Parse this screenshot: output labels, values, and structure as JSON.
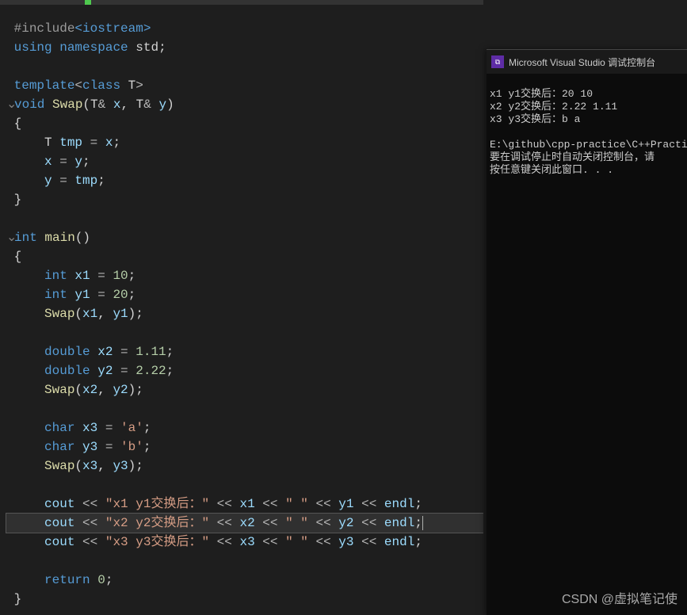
{
  "code": {
    "l1a": "#include",
    "l1b": "<iostream>",
    "l2a": "using",
    "l2b": " namespace ",
    "l2c": "std",
    "l2d": ";",
    "l4a": "template",
    "l4b": "<",
    "l4c": "class",
    "l4d": " T",
    "l4e": ">",
    "l5a": "void",
    "l5b": "Swap",
    "l5c": "(",
    "l5d": "T",
    "l5e": "&",
    "l5f": " x",
    "l5g": ", ",
    "l5h": "T",
    "l5i": "&",
    "l5j": " y",
    "l5k": ")",
    "l6": "{",
    "l7a": "T",
    "l7b": " tmp ",
    "l7c": "=",
    "l7d": " x",
    "l7e": ";",
    "l8a": "x ",
    "l8b": "=",
    "l8c": " y",
    "l8d": ";",
    "l9a": "y ",
    "l9b": "=",
    "l9c": " tmp",
    "l9d": ";",
    "l10": "}",
    "l12a": "int",
    "l12b": "main",
    "l12c": "()",
    "l13": "{",
    "l14a": "int",
    "l14b": " x1 ",
    "l14c": "=",
    "l14d": " 10",
    "l14e": ";",
    "l15a": "int",
    "l15b": " y1 ",
    "l15c": "=",
    "l15d": " 20",
    "l15e": ";",
    "l16a": "Swap",
    "l16b": "(",
    "l16c": "x1",
    "l16d": ", ",
    "l16e": "y1",
    "l16f": ")",
    "l16g": ";",
    "l18a": "double",
    "l18b": " x2 ",
    "l18c": "=",
    "l18d": " 1.11",
    "l18e": ";",
    "l19a": "double",
    "l19b": " y2 ",
    "l19c": "=",
    "l19d": " 2.22",
    "l19e": ";",
    "l20a": "Swap",
    "l20b": "(",
    "l20c": "x2",
    "l20d": ", ",
    "l20e": "y2",
    "l20f": ")",
    "l20g": ";",
    "l22a": "char",
    "l22b": " x3 ",
    "l22c": "=",
    "l22d": " 'a'",
    "l22e": ";",
    "l23a": "char",
    "l23b": " y3 ",
    "l23c": "=",
    "l23d": " 'b'",
    "l23e": ";",
    "l24a": "Swap",
    "l24b": "(",
    "l24c": "x3",
    "l24d": ", ",
    "l24e": "y3",
    "l24f": ")",
    "l24g": ";",
    "l26a": "cout ",
    "l26b": "<<",
    "l26c": " \"x1 y1交换后：\" ",
    "l26d": "<<",
    "l26e": " x1 ",
    "l26f": "<<",
    "l26g": " \" \" ",
    "l26h": "<<",
    "l26i": " y1 ",
    "l26j": "<<",
    "l26k": " endl",
    "l26l": ";",
    "l27a": "cout ",
    "l27b": "<<",
    "l27c": " \"x2 y2交换后：\" ",
    "l27d": "<<",
    "l27e": " x2 ",
    "l27f": "<<",
    "l27g": " \" \" ",
    "l27h": "<<",
    "l27i": " y2 ",
    "l27j": "<<",
    "l27k": " endl",
    "l27l": ";",
    "l28a": "cout ",
    "l28b": "<<",
    "l28c": " \"x3 y3交换后：\" ",
    "l28d": "<<",
    "l28e": " x3 ",
    "l28f": "<<",
    "l28g": " \" \" ",
    "l28h": "<<",
    "l28i": " y3 ",
    "l28j": "<<",
    "l28k": " endl",
    "l28l": ";",
    "l30a": "return",
    "l30b": " 0",
    "l30c": ";",
    "l31": "}"
  },
  "console": {
    "title": "Microsoft Visual Studio 调试控制台",
    "line1": "x1 y1交换后：20 10",
    "line2": "x2 y2交换后：2.22 1.11",
    "line3": "x3 y3交换后：b a",
    "line4": "",
    "line5": "E:\\github\\cpp-practice\\C++Practi",
    "line6": "要在调试停止时自动关闭控制台，请",
    "line7": "按任意键关闭此窗口. . ."
  },
  "watermark": "CSDN @虚拟笔记使",
  "icon_text": "⧉"
}
